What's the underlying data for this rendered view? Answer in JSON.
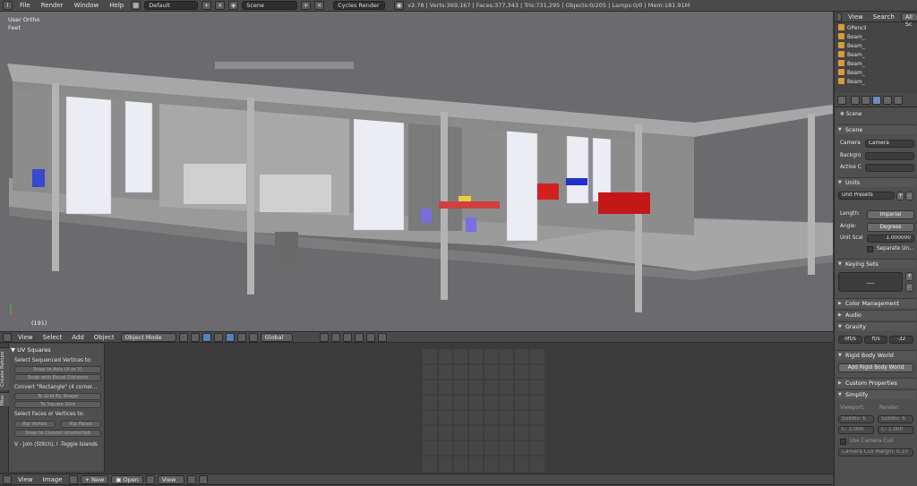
{
  "topbar": {
    "menus": [
      "File",
      "Render",
      "Window",
      "Help"
    ],
    "layout": "Default",
    "scene": "Scene",
    "engine": "Cycles Render",
    "stats": "v2.78 | Verts:369,167 | Faces:377,343 | Tris:731,295 | Objects:0/205 | Lamps:0/0 | Mem:181.91M"
  },
  "viewport": {
    "view_name": "User Ortho",
    "units": "Feet",
    "frame": "(191)",
    "header": {
      "menus": [
        "View",
        "Select",
        "Add",
        "Object"
      ],
      "mode": "Object Mode",
      "orientation": "Global"
    }
  },
  "toolshelf": {
    "tabs": [
      "Create Retopo",
      "Misc"
    ],
    "panel_title": "UV Squares",
    "label_sequenced": "Select Sequenced Vertices to:",
    "btn_snap_axis": "Snap to Axis (X or Y)",
    "btn_snap_equal": "Snap with Equal Distance",
    "label_convert": "Convert \"Rectangle\" (4 corner...",
    "btn_grid_shape": "To Grid By Shape",
    "btn_square_grid": "To Square Grid",
    "label_faces": "Select Faces or Vertices to:",
    "btn_rip_vertex": "Rip Vertex",
    "btn_rip_faces": "Rip Faces",
    "btn_snap_closest": "Snap to Closest Unselected",
    "hint": "V - Join (Stitch), I -Toggle Islands"
  },
  "uv_header": {
    "menus": [
      "View",
      "Image"
    ],
    "new_label": "New",
    "open_label": "Open",
    "view_label": "View"
  },
  "outliner": {
    "tabs": [
      "View",
      "Search",
      "All Sc"
    ],
    "items": [
      "GPencil",
      "Beam_",
      "Beam_",
      "Beam_",
      "Beam_",
      "Beam_",
      "Beam_"
    ]
  },
  "properties": {
    "scene_label": "Scene",
    "sec_scene": "Scene",
    "camera_label": "Camera",
    "camera_value": "Camera",
    "background_label": "Backgro",
    "active_clip_label": "Active C",
    "sec_units": "Units",
    "unit_presets": "Unit Presets",
    "length_label": "Length:",
    "length_value": "Imperial",
    "angle_label": "Angle:",
    "angle_value": "Degrees",
    "scale_label": "Unit Scal",
    "scale_value": "1.000000",
    "separate_units": "Separate Un...",
    "sec_keying": "Keying Sets",
    "keying_dash": "___",
    "sec_color": "Color Management",
    "sec_audio": "Audio",
    "sec_gravity": "Gravity",
    "gravity_x": "0ft/s",
    "gravity_y": "ft/s",
    "gravity_z": "-32",
    "sec_rigid": "Rigid Body World",
    "add_rigid": "Add Rigid Body World",
    "sec_custom": "Custom Properties",
    "sec_simplify": "Simplify",
    "viewport_label": "Viewport:",
    "render_label": "Render:",
    "subdiv_vp": "Subdiv: 6",
    "subdiv_r": "Subdiv: 6",
    "c_vp": "C: 1.000",
    "c_r": "C: 1.000",
    "use_camera_cull": "Use Camera Cull",
    "camera_cull_margin": "Camera Cull Margin: 0.10"
  }
}
